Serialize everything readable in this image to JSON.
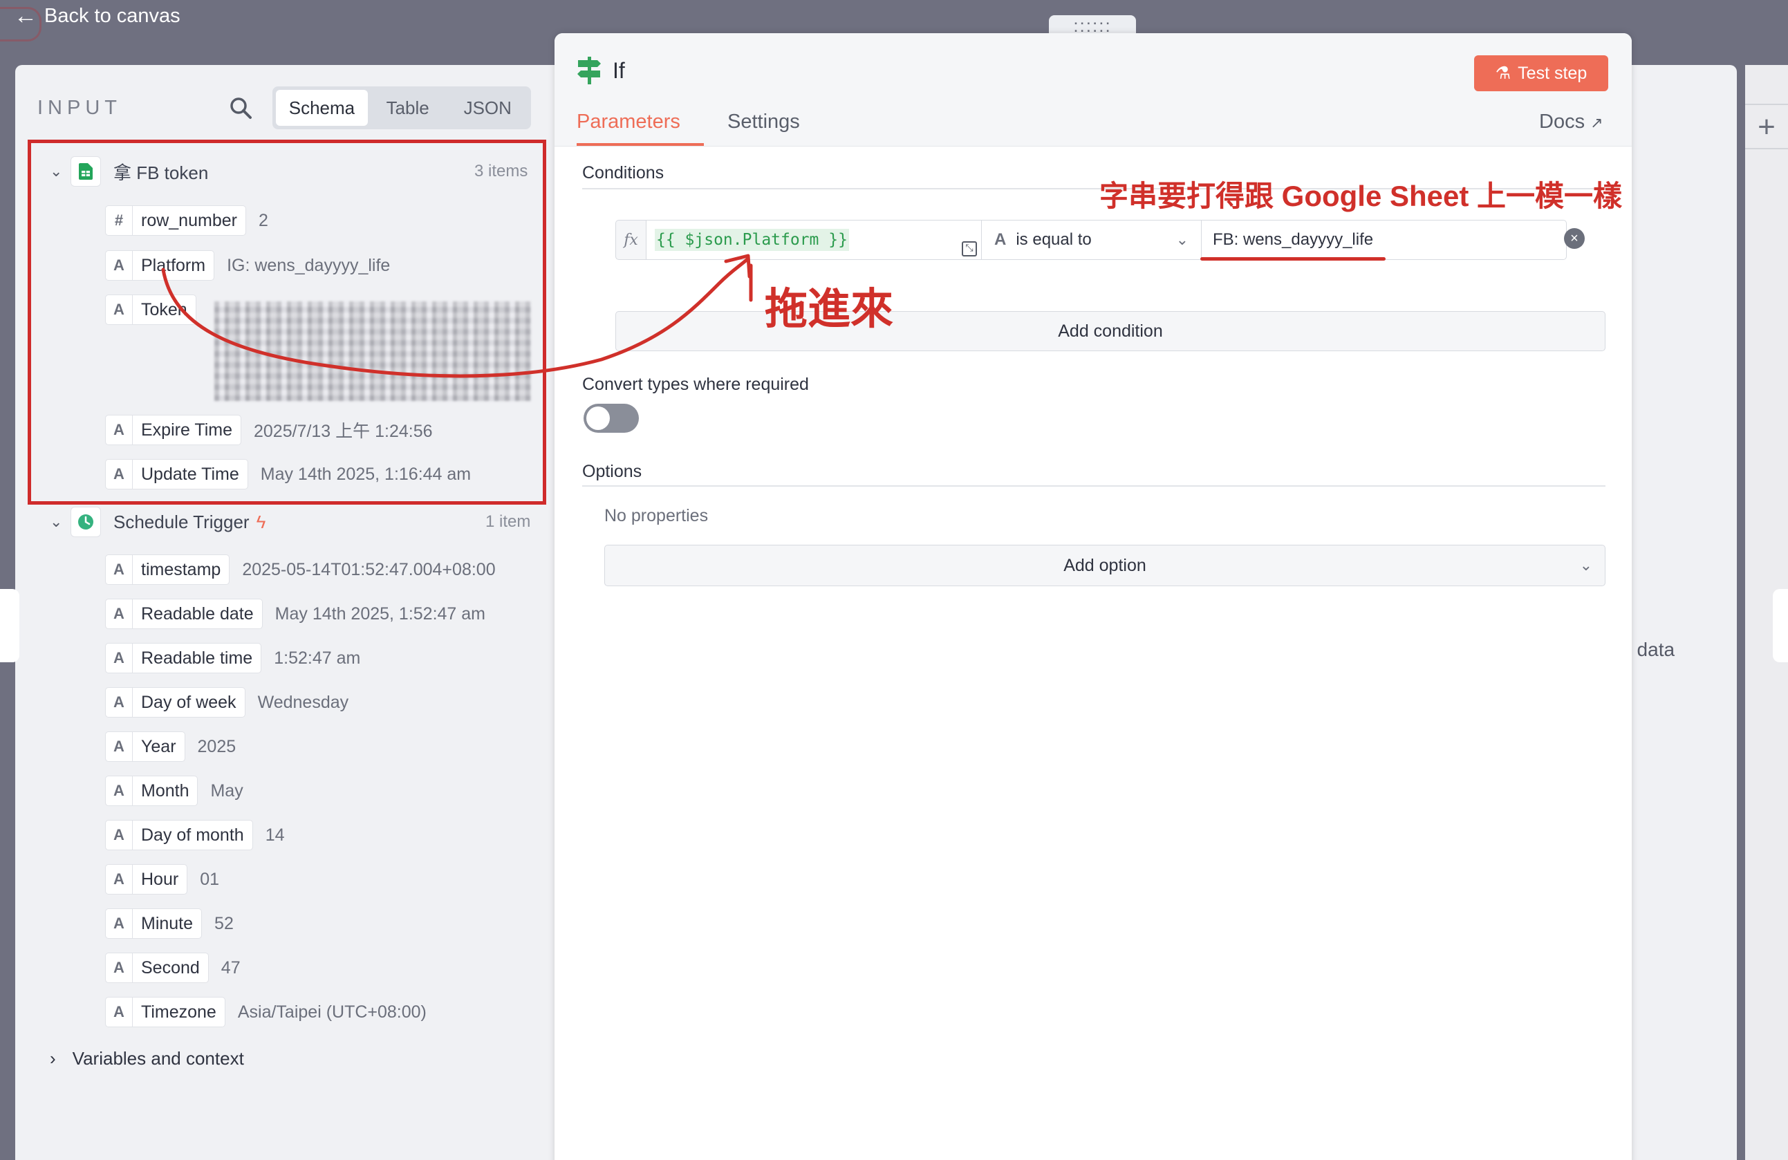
{
  "topbar": {
    "back_label": "Back to canvas"
  },
  "input_panel": {
    "header": "INPUT",
    "view_tabs": [
      "Schema",
      "Table",
      "JSON"
    ],
    "active_view": "Schema",
    "nodes": [
      {
        "name": "拿 FB token",
        "count": "3 items",
        "fields": [
          {
            "type": "#",
            "name": "row_number",
            "value": "2"
          },
          {
            "type": "A",
            "name": "Platform",
            "value": "IG: wens_dayyyy_life"
          },
          {
            "type": "A",
            "name": "Token",
            "value": ""
          },
          {
            "type": "A",
            "name": "Expire Time",
            "value": "2025/7/13 上午 1:24:56"
          },
          {
            "type": "A",
            "name": "Update Time",
            "value": "May 14th 2025, 1:16:44 am"
          }
        ]
      },
      {
        "name": "Schedule Trigger",
        "count": "1 item",
        "fields": [
          {
            "type": "A",
            "name": "timestamp",
            "value": "2025-05-14T01:52:47.004+08:00"
          },
          {
            "type": "A",
            "name": "Readable date",
            "value": "May 14th 2025, 1:52:47 am"
          },
          {
            "type": "A",
            "name": "Readable time",
            "value": "1:52:47 am"
          },
          {
            "type": "A",
            "name": "Day of week",
            "value": "Wednesday"
          },
          {
            "type": "A",
            "name": "Year",
            "value": "2025"
          },
          {
            "type": "A",
            "name": "Month",
            "value": "May"
          },
          {
            "type": "A",
            "name": "Day of month",
            "value": "14"
          },
          {
            "type": "A",
            "name": "Hour",
            "value": "01"
          },
          {
            "type": "A",
            "name": "Minute",
            "value": "52"
          },
          {
            "type": "A",
            "name": "Second",
            "value": "47"
          },
          {
            "type": "A",
            "name": "Timezone",
            "value": "Asia/Taipei (UTC+08:00)"
          }
        ]
      }
    ],
    "variables_label": "Variables and context"
  },
  "node_panel": {
    "title": "If",
    "test_step_label": "Test step",
    "tabs": [
      "Parameters",
      "Settings"
    ],
    "active_tab": "Parameters",
    "docs_label": "Docs",
    "conditions_label": "Conditions",
    "condition": {
      "fx": "fx",
      "left_value": "{{ $json.Platform }}",
      "operator_type": "A",
      "operator": "is equal to",
      "right_value": "FB: wens_dayyyy_life"
    },
    "add_condition_label": "Add condition",
    "convert_types_label": "Convert types where required",
    "convert_types_enabled": false,
    "options_label": "Options",
    "no_properties_label": "No properties",
    "add_option_label": "Add option"
  },
  "output_panel": {
    "edge_text": "/ data"
  },
  "annotations": {
    "top_note": "字串要打得跟 Google Sheet 上一模一樣",
    "drag_note": "拖進來",
    "color": "#d0302a"
  },
  "colors": {
    "accent": "#ee6d57",
    "annotation": "#d0302a",
    "expression": "#2b9b4d"
  }
}
